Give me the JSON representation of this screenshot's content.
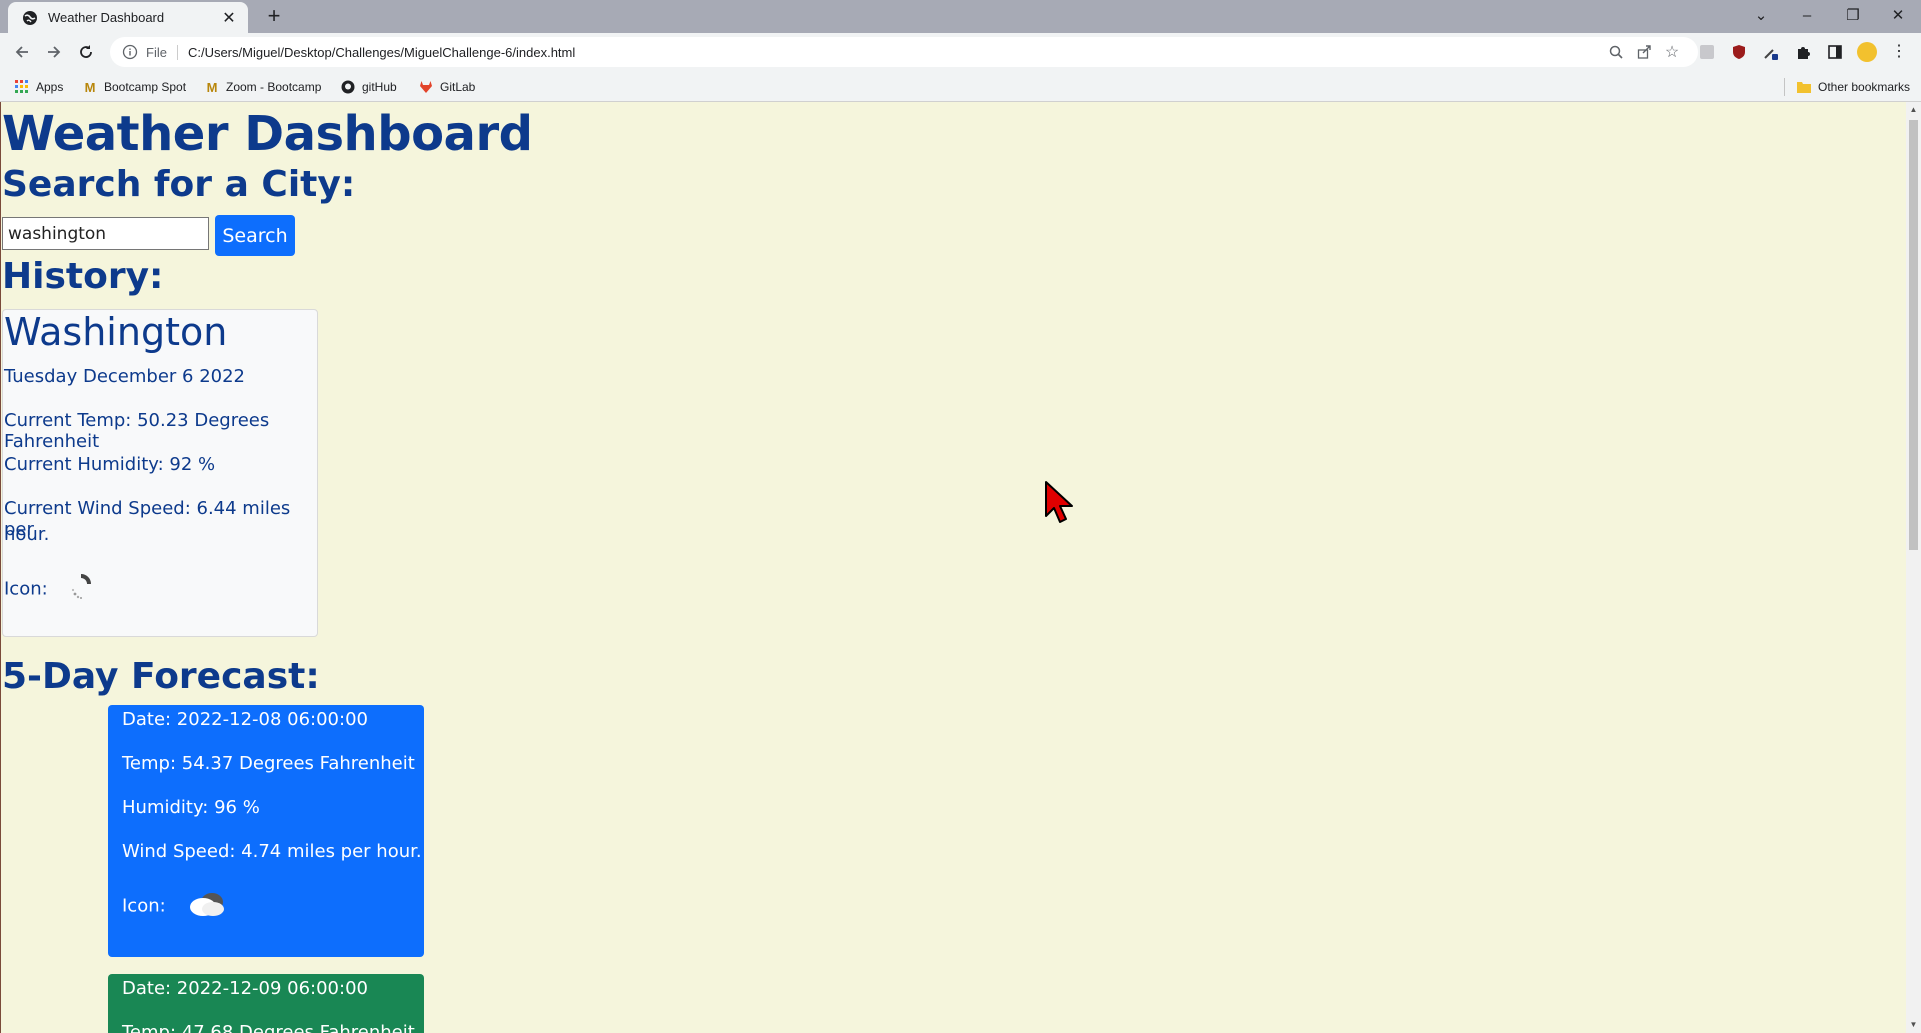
{
  "browser": {
    "tab_title": "Weather Dashboard",
    "url_scheme": "File",
    "url": "C:/Users/Miguel/Desktop/Challenges/MiguelChallenge-6/index.html",
    "bookmarks": [
      "Apps",
      "Bootcamp Spot",
      "Zoom - Bootcamp",
      "gitHub",
      "GitLab"
    ],
    "other_bookmarks": "Other bookmarks"
  },
  "page": {
    "title": "Weather Dashboard",
    "search_heading": "Search for a City:",
    "search_value": "washington",
    "search_button": "Search",
    "history_heading": "History:",
    "forecast_heading": "5-Day Forecast:"
  },
  "current": {
    "city": "Washington",
    "date": "Tuesday December 6 2022",
    "temp": "Current Temp: 50.23 Degrees Fahrenheit",
    "humidity": "Current Humidity: 92 %",
    "wind_line1": "Current Wind Speed: 6.44 miles per",
    "wind_line2": "hour.",
    "icon_label": "Icon:",
    "icon": "loading-spinner-icon"
  },
  "forecast": [
    {
      "date": "Date: 2022-12-08 06:00:00",
      "temp": "Temp: 54.37 Degrees Fahrenheit",
      "humidity": "Humidity: 96 %",
      "wind": "Wind Speed: 4.74 miles per hour.",
      "icon_label": "Icon:",
      "icon": "cloud-icon",
      "color": "#0d6efd"
    },
    {
      "date": "Date: 2022-12-09 06:00:00",
      "temp_partial": "Temp: 47.68 Degrees Fahrenheit",
      "color": "#198754"
    }
  ]
}
